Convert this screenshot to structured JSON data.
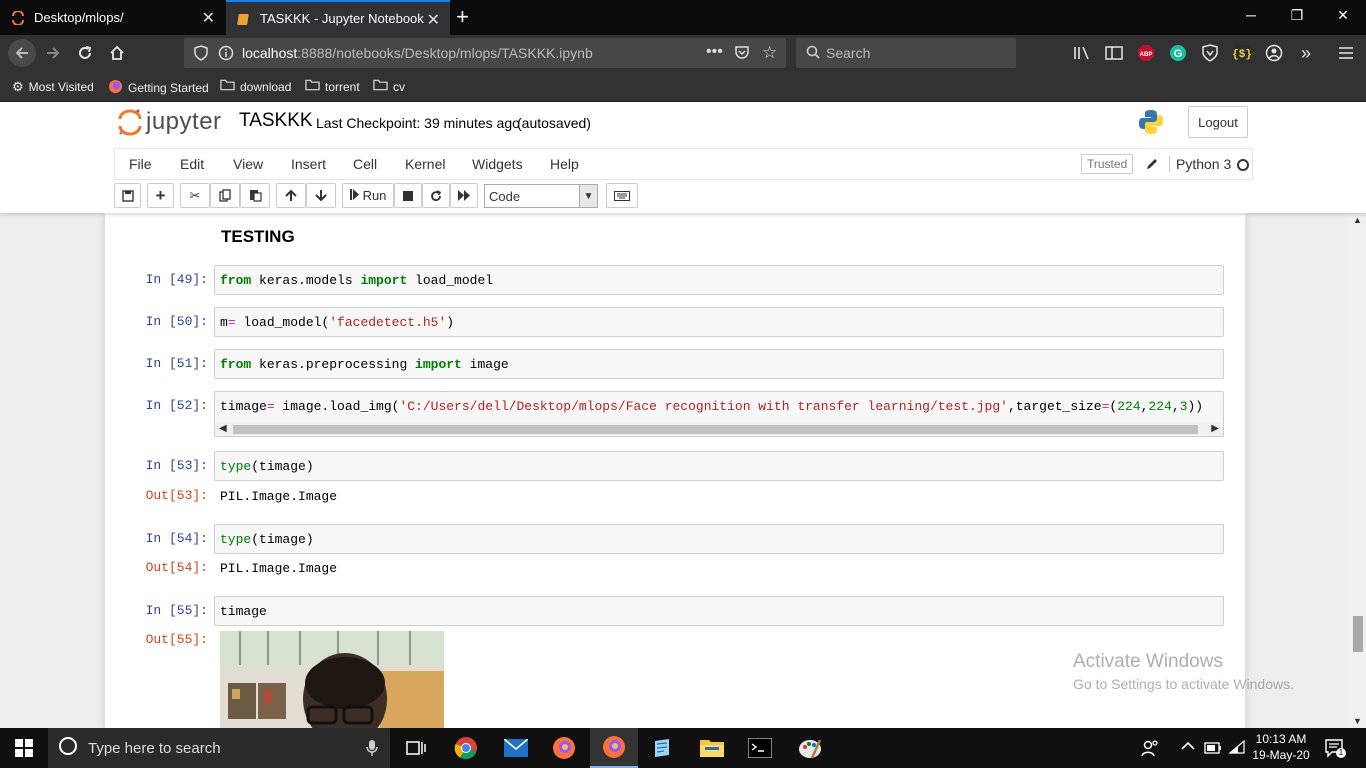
{
  "browser": {
    "tabs": [
      {
        "title": "Desktop/mlops/"
      },
      {
        "title": "TASKKK - Jupyter Notebook"
      }
    ],
    "url": {
      "host": "localhost",
      "path": ":8888/notebooks/Desktop/mlops/TASKKK.ipynb"
    },
    "search_placeholder": "Search",
    "bookmarks": [
      "Most Visited",
      "Getting Started",
      "download",
      "torrent",
      "cv"
    ]
  },
  "jupyter": {
    "logo_text": "jupyter",
    "notebook_name": "TASKKK",
    "checkpoint": "Last Checkpoint: 39 minutes ago",
    "autosave": "(autosaved)",
    "logout_label": "Logout",
    "menu": [
      "File",
      "Edit",
      "View",
      "Insert",
      "Cell",
      "Kernel",
      "Widgets",
      "Help"
    ],
    "trusted_label": "Trusted",
    "kernel_name": "Python 3",
    "toolbar": {
      "run_label": "Run",
      "cell_type": "Code"
    }
  },
  "notebook": {
    "heading": "TESTING",
    "cells": [
      {
        "prompt": "In [49]:"
      },
      {
        "prompt": "In [50]:"
      },
      {
        "prompt": "In [51]:"
      },
      {
        "prompt": "In [52]:"
      },
      {
        "prompt": "In [53]:",
        "out_prompt": "Out[53]:",
        "output": "PIL.Image.Image"
      },
      {
        "prompt": "In [54]:",
        "out_prompt": "Out[54]:",
        "output": "PIL.Image.Image"
      },
      {
        "prompt": "In [55]:",
        "out_prompt": "Out[55]:"
      }
    ],
    "code": {
      "c49": [
        "from",
        " keras.models ",
        "import",
        " load_model"
      ],
      "c50": [
        "m",
        "=",
        " load_model(",
        "'facedetect.h5'",
        ")"
      ],
      "c51": [
        "from",
        " keras.preprocessing ",
        "import",
        " image"
      ],
      "c52": [
        "timage",
        "=",
        " image.load_img(",
        "'C:/Users/dell/Desktop/mlops/Face recognition with transfer learning/test.jpg'",
        ",target_size",
        "=",
        "(",
        "224",
        ",",
        "224",
        ",",
        "3",
        "))"
      ],
      "c53": [
        "type",
        "(timage)"
      ],
      "c54": [
        "type",
        "(timage)"
      ],
      "c55": [
        "timage"
      ]
    }
  },
  "watermark": {
    "title": "Activate Windows",
    "subtitle": "Go to Settings to activate Windows."
  },
  "taskbar": {
    "search_placeholder": "Type here to search",
    "time": "10:13 AM",
    "date": "19-May-20"
  }
}
